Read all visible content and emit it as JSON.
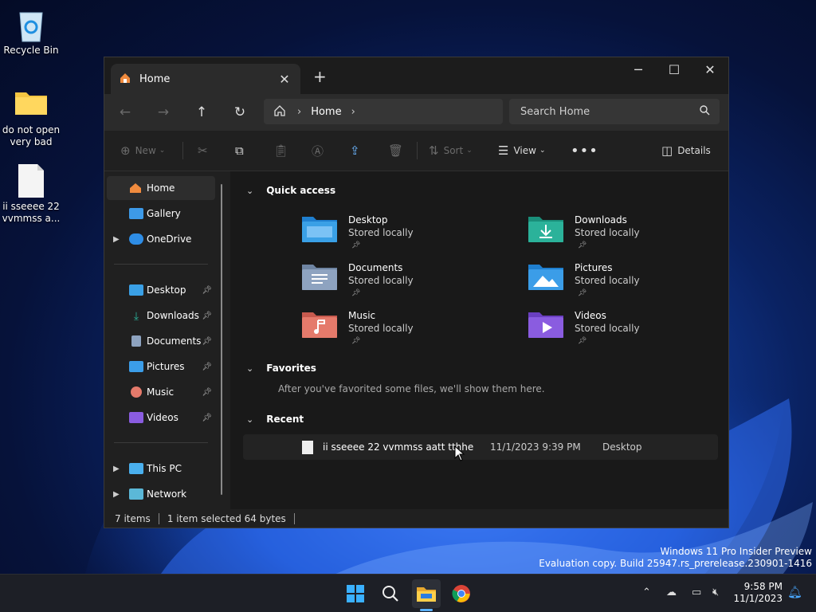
{
  "desktop": {
    "icons": [
      {
        "label": "Recycle Bin"
      },
      {
        "label": "do not open very bad"
      },
      {
        "label": "ii  sseeee  22 vvmmss  a..."
      }
    ]
  },
  "explorer": {
    "tab_title": "Home",
    "address": {
      "crumb": "Home"
    },
    "search": {
      "placeholder": "Search Home"
    },
    "toolbar": {
      "new_label": "New",
      "sort_label": "Sort",
      "view_label": "View",
      "details_label": "Details"
    },
    "sidebar": {
      "top": [
        "Home",
        "Gallery",
        "OneDrive"
      ],
      "pinned": [
        "Desktop",
        "Downloads",
        "Documents",
        "Pictures",
        "Music",
        "Videos"
      ],
      "bottom": [
        "This PC",
        "Network"
      ]
    },
    "quick_access": {
      "heading": "Quick access",
      "items": [
        {
          "name": "Desktop",
          "status": "Stored locally",
          "color": "#3aa0e6"
        },
        {
          "name": "Downloads",
          "status": "Stored locally",
          "color": "#2bb29a"
        },
        {
          "name": "Documents",
          "status": "Stored locally",
          "color": "#8ea3c0"
        },
        {
          "name": "Pictures",
          "status": "Stored locally",
          "color": "#3b9de8"
        },
        {
          "name": "Music",
          "status": "Stored locally",
          "color": "#e57a6b"
        },
        {
          "name": "Videos",
          "status": "Stored locally",
          "color": "#8a5ce0"
        }
      ]
    },
    "favorites": {
      "heading": "Favorites",
      "note": "After you've favorited some files, we'll show them here."
    },
    "recent": {
      "heading": "Recent",
      "rows": [
        {
          "name": "ii  sseeee  22  vvmmss  aatt  tthhe",
          "date": "11/1/2023 9:39 PM",
          "location": "Desktop"
        }
      ]
    },
    "status": {
      "items": "7 items",
      "selected": "1 item selected  64 bytes"
    }
  },
  "watermark": {
    "line1": "Windows 11 Pro Insider Preview",
    "line2": "Evaluation copy. Build 25947.rs_prerelease.230901-1416"
  },
  "taskbar": {
    "time": "9:58 PM",
    "date": "11/1/2023"
  }
}
